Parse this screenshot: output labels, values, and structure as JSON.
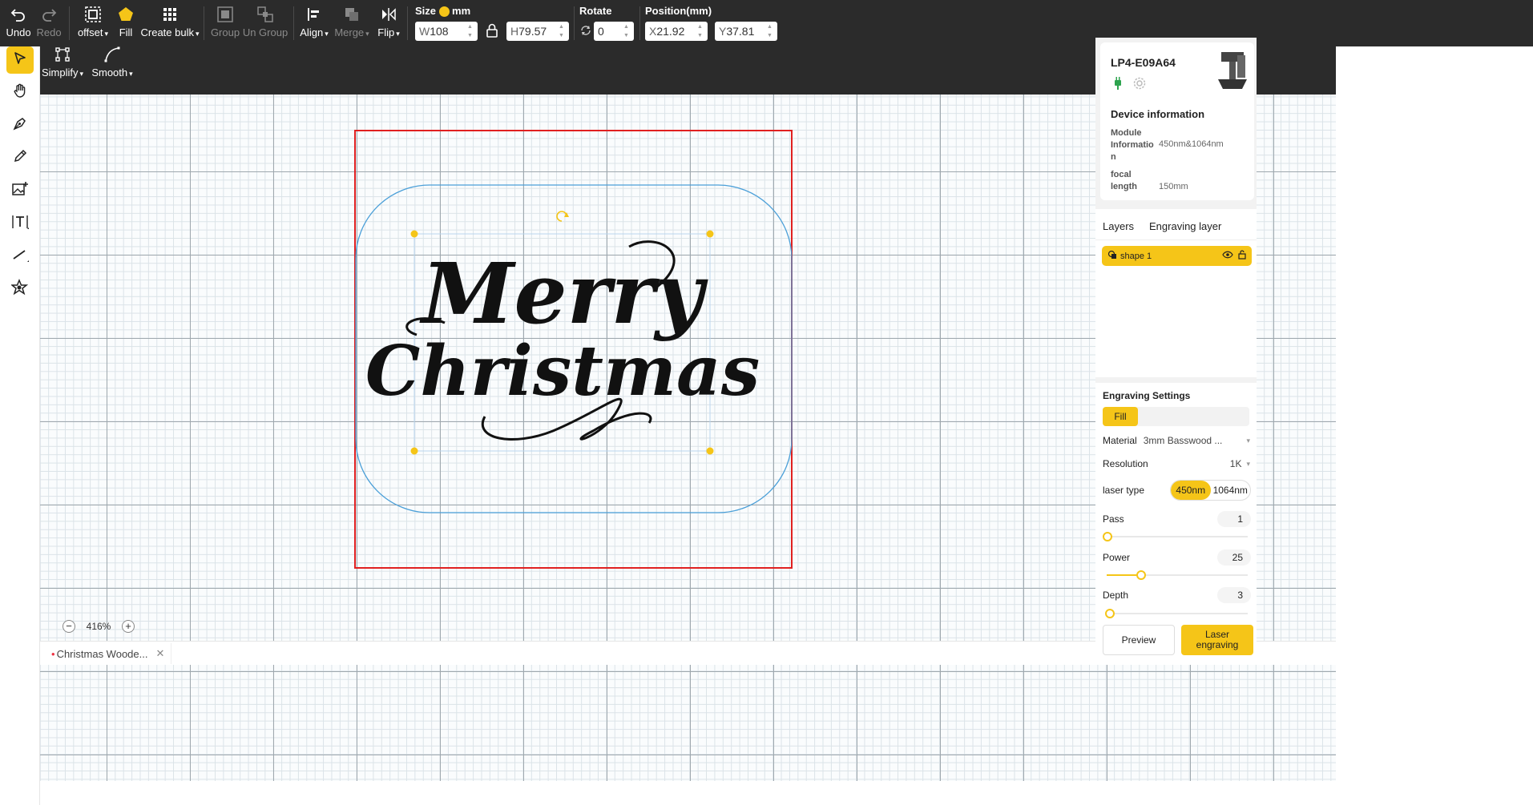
{
  "toolbar": {
    "undo": "Undo",
    "redo": "Redo",
    "offset": "offset",
    "fill": "Fill",
    "create_bulk": "Create bulk",
    "group": "Group",
    "ungroup": "Un Group",
    "align": "Align",
    "merge": "Merge",
    "flip": "Flip",
    "size_label": "Size",
    "unit": "mm",
    "width_value": "108",
    "width_prefix": "W",
    "height_value": "79.57",
    "height_prefix": "H",
    "rotate_label": "Rotate",
    "rotate_value": "0",
    "position_label": "Position(mm)",
    "x_value": "21.92",
    "x_prefix": "X",
    "y_value": "37.81",
    "y_prefix": "Y"
  },
  "subbar": {
    "simplify": "Simplify",
    "smooth": "Smooth"
  },
  "canvas": {
    "zoom": "416%",
    "artwork_line1": "Merry",
    "artwork_line2": "Christmas"
  },
  "file_tab": {
    "name": "Christmas Woode..."
  },
  "device": {
    "name": "LP4-E09A64",
    "section_title": "Device information",
    "module_label": "Module Informatio n",
    "module_value": "450nm&1064nm",
    "focal_label": "focal length",
    "focal_value": "150mm"
  },
  "layers": {
    "tabs": [
      "Layers",
      "Engraving layer"
    ],
    "items": [
      {
        "name": "shape 1"
      }
    ]
  },
  "engraving": {
    "title": "Engraving Settings",
    "mode": "Fill",
    "material_label": "Material",
    "material_value": "3mm Basswood ...",
    "resolution_label": "Resolution",
    "resolution_value": "1K",
    "laser_type_label": "laser type",
    "laser_options": [
      "450nm",
      "1064nm"
    ],
    "selected_laser": "450nm",
    "pass_label": "Pass",
    "pass_value": "1",
    "pass_level": 0,
    "power_label": "Power",
    "power_value": "25",
    "power_level": 0.2,
    "depth_label": "Depth",
    "depth_value": "3",
    "depth_level": 0.02,
    "preview_button": "Preview",
    "laser_button": "Laser engraving"
  },
  "colors": {
    "accent": "#f5c518",
    "toolbar_bg": "#2b2b2b",
    "work_area_border": "#e02020",
    "selection_outline": "#4a9fd8"
  }
}
